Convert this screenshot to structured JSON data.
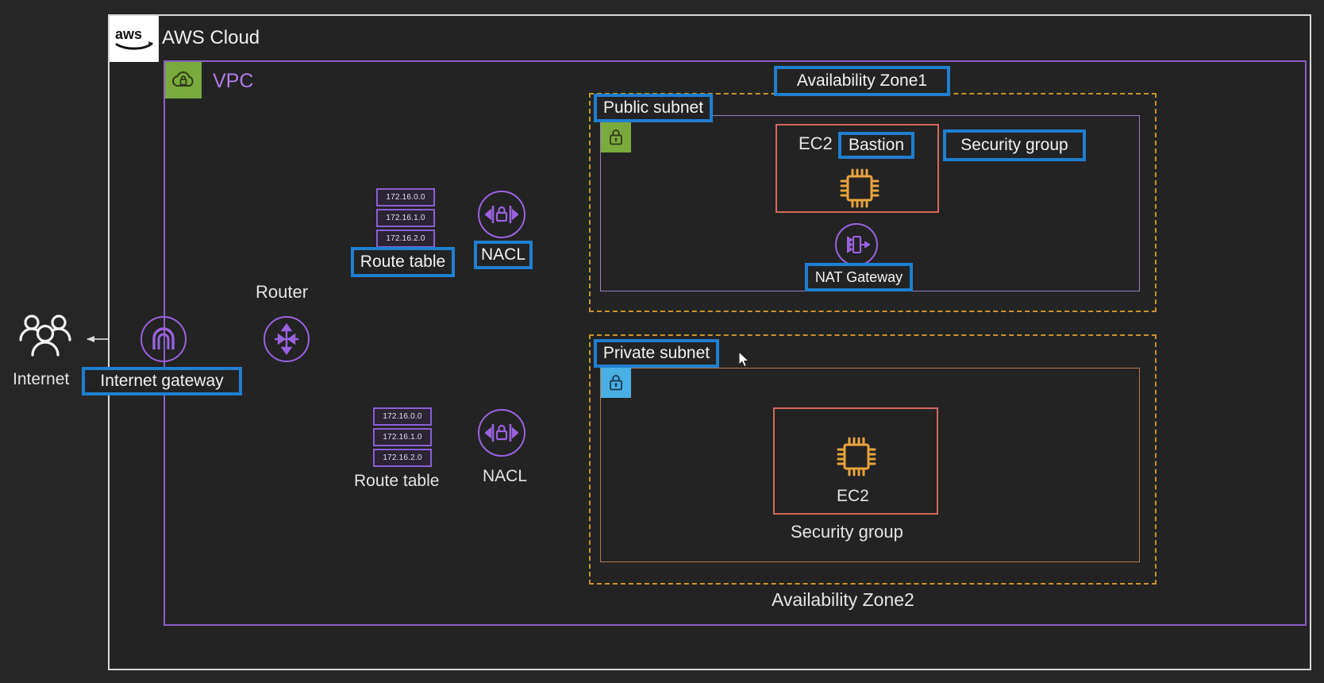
{
  "diagram": {
    "title": "AWS Cloud",
    "background_color": "#262626",
    "cloud": {
      "label": "AWS Cloud",
      "logo_text": "aws",
      "border_color": "#d8d8d8"
    },
    "vpc": {
      "label": "VPC",
      "icon": "vpc-cloud-lock-icon",
      "border_color": "#8c5ec9",
      "icon_bg": "#7aa93c"
    },
    "availability_zones": [
      {
        "label": "Availability Zone1",
        "highlighted": true,
        "border_color": "#c8912e"
      },
      {
        "label": "Availability Zone2",
        "highlighted": false,
        "border_color": "#c8912e"
      }
    ],
    "subnets": [
      {
        "label": "Public subnet",
        "lock_color": "#7aa93c",
        "icon": "lock-icon"
      },
      {
        "label": "Private subnet",
        "lock_color": "#4aafe3",
        "icon": "lock-icon"
      }
    ],
    "security_groups": [
      {
        "label": "Security group",
        "highlighted": true,
        "border_color": "#d5695b"
      },
      {
        "label": "Security group",
        "highlighted": false,
        "border_color": "#d5695b"
      }
    ],
    "compute": [
      {
        "label": "EC2",
        "tag": "Bastion",
        "tag_highlighted": true,
        "icon": "ec2-chip-icon",
        "color": "#e8a33d"
      },
      {
        "label": "EC2",
        "tag": "",
        "tag_highlighted": false,
        "icon": "ec2-chip-icon",
        "color": "#e8a33d"
      }
    ],
    "network_nodes": [
      {
        "label": "Internet",
        "icon": "users-icon",
        "highlighted": false,
        "color": "#ffffff"
      },
      {
        "label": "Internet gateway",
        "icon": "internet-gateway-icon",
        "highlighted": true,
        "color": "#9a63e0"
      },
      {
        "label": "Router",
        "icon": "router-icon",
        "highlighted": false,
        "color": "#9a63e0"
      },
      {
        "label": "NAT Gateway",
        "icon": "nat-gateway-icon",
        "highlighted": true,
        "color": "#9a63e0"
      }
    ],
    "nacls": [
      {
        "label": "NACL",
        "highlighted": true,
        "icon": "nacl-lock-icon"
      },
      {
        "label": "NACL",
        "highlighted": false,
        "icon": "nacl-lock-icon"
      }
    ],
    "route_tables": [
      {
        "label": "Route table",
        "highlighted": true,
        "routes": [
          "172.16.0.0",
          "172.16.1.0",
          "172.16.2.0"
        ]
      },
      {
        "label": "Route table",
        "highlighted": false,
        "routes": [
          "172.16.0.0",
          "172.16.1.0",
          "172.16.2.0"
        ]
      }
    ],
    "colors": {
      "highlight_blue": "#1f7fd0",
      "purple": "#9a63e0",
      "orange_dashed": "#c8912e",
      "salmon": "#d5695b",
      "green": "#7aa93c",
      "cyan": "#4aafe3",
      "wire": "#b9b9b9"
    }
  }
}
